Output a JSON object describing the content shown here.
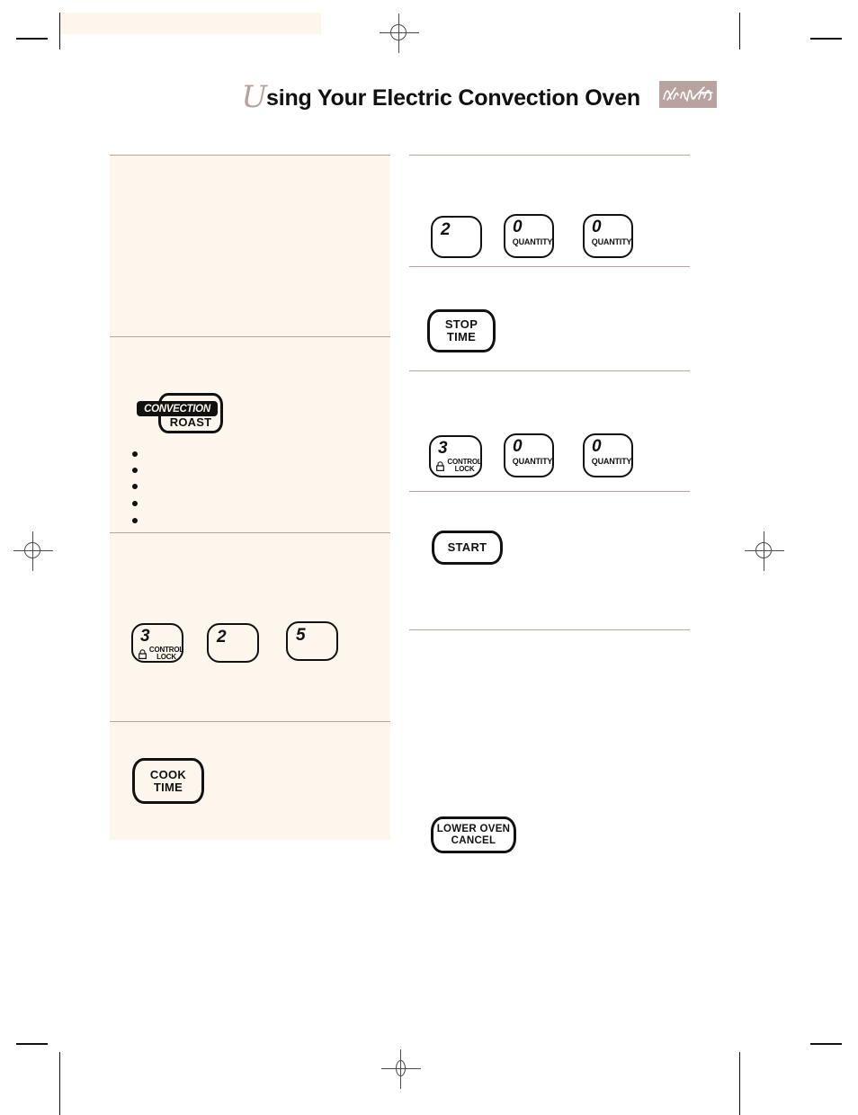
{
  "page": {
    "title_dropcap": "U",
    "title_rest": "sing Your Electric Convection Oven",
    "brand_mark": "kitchenaid-signature",
    "background_color": "#ffffff",
    "panel_color": "#fdf6ec",
    "rule_color": "#b8a3a0",
    "ink_color": "#111111"
  },
  "printer_marks": {
    "registration_mark_name": "registration-target",
    "crop_mark_name": "crop-mark"
  },
  "left_column": {
    "name": "instruction-column-left",
    "sections": [
      {
        "name": "section-one"
      },
      {
        "name": "section-two"
      },
      {
        "name": "section-three"
      },
      {
        "name": "section-four"
      }
    ],
    "convection_roast_button": {
      "line1": "CONVECTION",
      "line2": "ROAST"
    },
    "bullets": [
      {
        "name": "bullet-1"
      },
      {
        "name": "bullet-2"
      },
      {
        "name": "bullet-3"
      },
      {
        "name": "bullet-4"
      },
      {
        "name": "bullet-5"
      }
    ],
    "keypad_row": [
      {
        "digit": "3",
        "caption_line1": "CONTROL",
        "caption_line2": "LOCK",
        "icon": "padlock-icon"
      },
      {
        "digit": "2",
        "caption_line1": "",
        "caption_line2": "",
        "icon": ""
      },
      {
        "digit": "5",
        "caption_line1": "",
        "caption_line2": "",
        "icon": ""
      }
    ],
    "cook_time_button": {
      "line1": "COOK",
      "line2": "TIME"
    }
  },
  "right_column": {
    "name": "instruction-column-right",
    "keypad_row_1": [
      {
        "digit": "2",
        "caption": ""
      },
      {
        "digit": "0",
        "caption": "QUANTITY"
      },
      {
        "digit": "0",
        "caption": "QUANTITY"
      }
    ],
    "stop_time_button": {
      "line1": "STOP",
      "line2": "TIME"
    },
    "keypad_row_2": [
      {
        "digit": "3",
        "caption_line1": "CONTROL",
        "caption_line2": "LOCK",
        "icon": "padlock-icon"
      },
      {
        "digit": "0",
        "caption": "QUANTITY"
      },
      {
        "digit": "0",
        "caption": "QUANTITY"
      }
    ],
    "start_button": {
      "label": "START"
    },
    "lower_oven_cancel_button": {
      "line1": "LOWER OVEN",
      "line2": "CANCEL"
    }
  }
}
